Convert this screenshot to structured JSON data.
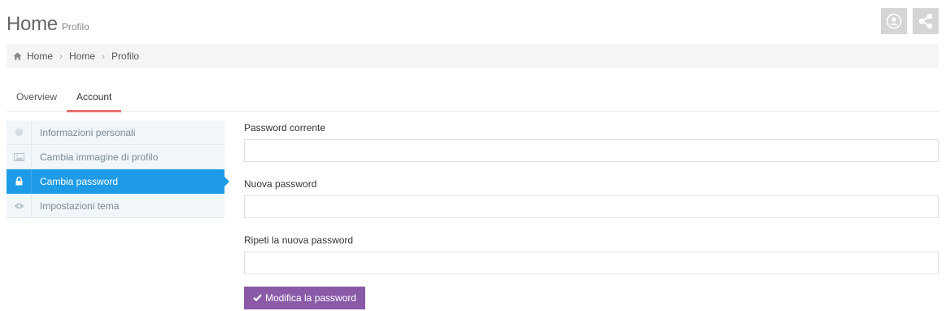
{
  "header": {
    "title": "Home",
    "subtitle": "Profilo",
    "actions": [
      {
        "icon": "user-circle-icon"
      },
      {
        "icon": "share-icon"
      }
    ]
  },
  "breadcrumb": {
    "items": [
      "Home",
      "Home",
      "Profilo"
    ]
  },
  "tabs": [
    {
      "label": "Overview",
      "active": false
    },
    {
      "label": "Account",
      "active": true
    }
  ],
  "side_menu": [
    {
      "label": "Informazioni personali",
      "icon": "gear-icon",
      "active": false
    },
    {
      "label": "Cambia immagine di profilo",
      "icon": "picture-icon",
      "active": false
    },
    {
      "label": "Cambia password",
      "icon": "lock-icon",
      "active": true
    },
    {
      "label": "Impostazioni tema",
      "icon": "eye-icon",
      "active": false
    }
  ],
  "form": {
    "current_password": {
      "label": "Password corrente",
      "value": "",
      "placeholder": ""
    },
    "new_password": {
      "label": "Nuova password",
      "value": "",
      "placeholder": ""
    },
    "repeat_password": {
      "label": "Ripeti la nuova password",
      "value": "",
      "placeholder": ""
    },
    "submit_label": "Modifica la password"
  },
  "colors": {
    "accent_blue": "#1e9be6",
    "submit_purple": "#8a5aa8",
    "tab_underline": "#e57373"
  }
}
